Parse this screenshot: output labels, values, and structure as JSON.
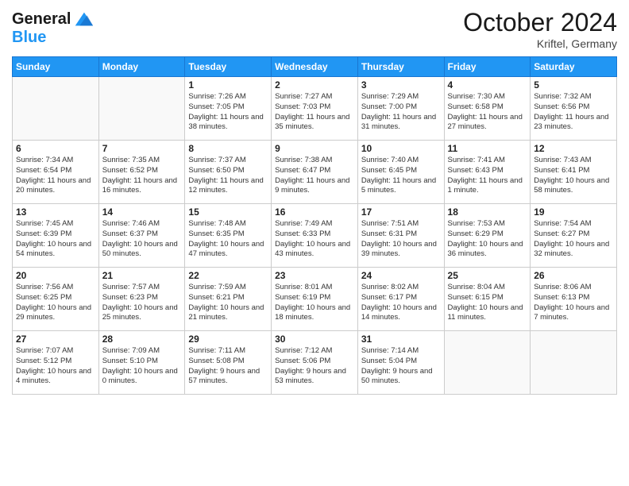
{
  "header": {
    "logo_line1": "General",
    "logo_line2": "Blue",
    "month_year": "October 2024",
    "location": "Kriftel, Germany"
  },
  "weekdays": [
    "Sunday",
    "Monday",
    "Tuesday",
    "Wednesday",
    "Thursday",
    "Friday",
    "Saturday"
  ],
  "weeks": [
    [
      {
        "day": "",
        "info": ""
      },
      {
        "day": "",
        "info": ""
      },
      {
        "day": "1",
        "info": "Sunrise: 7:26 AM\nSunset: 7:05 PM\nDaylight: 11 hours and 38 minutes."
      },
      {
        "day": "2",
        "info": "Sunrise: 7:27 AM\nSunset: 7:03 PM\nDaylight: 11 hours and 35 minutes."
      },
      {
        "day": "3",
        "info": "Sunrise: 7:29 AM\nSunset: 7:00 PM\nDaylight: 11 hours and 31 minutes."
      },
      {
        "day": "4",
        "info": "Sunrise: 7:30 AM\nSunset: 6:58 PM\nDaylight: 11 hours and 27 minutes."
      },
      {
        "day": "5",
        "info": "Sunrise: 7:32 AM\nSunset: 6:56 PM\nDaylight: 11 hours and 23 minutes."
      }
    ],
    [
      {
        "day": "6",
        "info": "Sunrise: 7:34 AM\nSunset: 6:54 PM\nDaylight: 11 hours and 20 minutes."
      },
      {
        "day": "7",
        "info": "Sunrise: 7:35 AM\nSunset: 6:52 PM\nDaylight: 11 hours and 16 minutes."
      },
      {
        "day": "8",
        "info": "Sunrise: 7:37 AM\nSunset: 6:50 PM\nDaylight: 11 hours and 12 minutes."
      },
      {
        "day": "9",
        "info": "Sunrise: 7:38 AM\nSunset: 6:47 PM\nDaylight: 11 hours and 9 minutes."
      },
      {
        "day": "10",
        "info": "Sunrise: 7:40 AM\nSunset: 6:45 PM\nDaylight: 11 hours and 5 minutes."
      },
      {
        "day": "11",
        "info": "Sunrise: 7:41 AM\nSunset: 6:43 PM\nDaylight: 11 hours and 1 minute."
      },
      {
        "day": "12",
        "info": "Sunrise: 7:43 AM\nSunset: 6:41 PM\nDaylight: 10 hours and 58 minutes."
      }
    ],
    [
      {
        "day": "13",
        "info": "Sunrise: 7:45 AM\nSunset: 6:39 PM\nDaylight: 10 hours and 54 minutes."
      },
      {
        "day": "14",
        "info": "Sunrise: 7:46 AM\nSunset: 6:37 PM\nDaylight: 10 hours and 50 minutes."
      },
      {
        "day": "15",
        "info": "Sunrise: 7:48 AM\nSunset: 6:35 PM\nDaylight: 10 hours and 47 minutes."
      },
      {
        "day": "16",
        "info": "Sunrise: 7:49 AM\nSunset: 6:33 PM\nDaylight: 10 hours and 43 minutes."
      },
      {
        "day": "17",
        "info": "Sunrise: 7:51 AM\nSunset: 6:31 PM\nDaylight: 10 hours and 39 minutes."
      },
      {
        "day": "18",
        "info": "Sunrise: 7:53 AM\nSunset: 6:29 PM\nDaylight: 10 hours and 36 minutes."
      },
      {
        "day": "19",
        "info": "Sunrise: 7:54 AM\nSunset: 6:27 PM\nDaylight: 10 hours and 32 minutes."
      }
    ],
    [
      {
        "day": "20",
        "info": "Sunrise: 7:56 AM\nSunset: 6:25 PM\nDaylight: 10 hours and 29 minutes."
      },
      {
        "day": "21",
        "info": "Sunrise: 7:57 AM\nSunset: 6:23 PM\nDaylight: 10 hours and 25 minutes."
      },
      {
        "day": "22",
        "info": "Sunrise: 7:59 AM\nSunset: 6:21 PM\nDaylight: 10 hours and 21 minutes."
      },
      {
        "day": "23",
        "info": "Sunrise: 8:01 AM\nSunset: 6:19 PM\nDaylight: 10 hours and 18 minutes."
      },
      {
        "day": "24",
        "info": "Sunrise: 8:02 AM\nSunset: 6:17 PM\nDaylight: 10 hours and 14 minutes."
      },
      {
        "day": "25",
        "info": "Sunrise: 8:04 AM\nSunset: 6:15 PM\nDaylight: 10 hours and 11 minutes."
      },
      {
        "day": "26",
        "info": "Sunrise: 8:06 AM\nSunset: 6:13 PM\nDaylight: 10 hours and 7 minutes."
      }
    ],
    [
      {
        "day": "27",
        "info": "Sunrise: 7:07 AM\nSunset: 5:12 PM\nDaylight: 10 hours and 4 minutes."
      },
      {
        "day": "28",
        "info": "Sunrise: 7:09 AM\nSunset: 5:10 PM\nDaylight: 10 hours and 0 minutes."
      },
      {
        "day": "29",
        "info": "Sunrise: 7:11 AM\nSunset: 5:08 PM\nDaylight: 9 hours and 57 minutes."
      },
      {
        "day": "30",
        "info": "Sunrise: 7:12 AM\nSunset: 5:06 PM\nDaylight: 9 hours and 53 minutes."
      },
      {
        "day": "31",
        "info": "Sunrise: 7:14 AM\nSunset: 5:04 PM\nDaylight: 9 hours and 50 minutes."
      },
      {
        "day": "",
        "info": ""
      },
      {
        "day": "",
        "info": ""
      }
    ]
  ]
}
